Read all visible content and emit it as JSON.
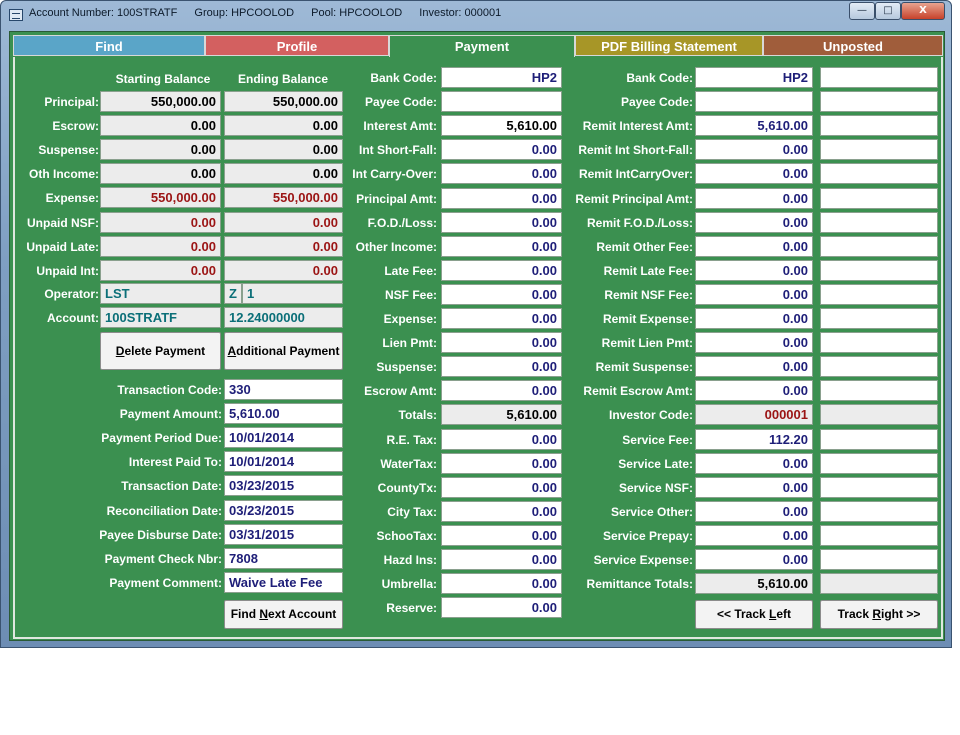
{
  "titlebar": {
    "segments": [
      "Account Number: 100STRATF",
      "Group: HPCOOLOD",
      "Pool: HPCOOLOD",
      "Investor: 000001"
    ],
    "minimize": "—",
    "maximize": "□",
    "close": "X"
  },
  "tabs": [
    {
      "label": "Find",
      "color": "#5aa5c8"
    },
    {
      "label": "Profile",
      "color": "#d36060"
    },
    {
      "label": "Payment",
      "color": "#3b9050"
    },
    {
      "label": "PDF Billing Statement",
      "color": "#a79627"
    },
    {
      "label": "Unposted",
      "color": "#a05d3b"
    }
  ],
  "balances": {
    "header_start": "Starting Balance",
    "header_end": "Ending Balance",
    "rows": [
      {
        "label": "Principal:",
        "start": "550,000.00",
        "end": "550,000.00",
        "color": "normal"
      },
      {
        "label": "Escrow:",
        "start": "0.00",
        "end": "0.00",
        "color": "normal"
      },
      {
        "label": "Suspense:",
        "start": "0.00",
        "end": "0.00",
        "color": "normal"
      },
      {
        "label": "Oth Income:",
        "start": "0.00",
        "end": "0.00",
        "color": "normal"
      },
      {
        "label": "Expense:",
        "start": "550,000.00",
        "end": "550,000.00",
        "color": "red"
      },
      {
        "label": "Unpaid NSF:",
        "start": "0.00",
        "end": "0.00",
        "color": "red"
      },
      {
        "label": "Unpaid Late:",
        "start": "0.00",
        "end": "0.00",
        "color": "red"
      },
      {
        "label": "Unpaid Int:",
        "start": "0.00",
        "end": "0.00",
        "color": "red"
      }
    ],
    "operator_label": "Operator:",
    "operator_value": "LST",
    "operator_code": "Z",
    "operator_num": "1",
    "account_label": "Account:",
    "account_value": "100STRATF",
    "account_rate": "12.24000000"
  },
  "buttons": {
    "delete": "Delete Payment",
    "additional": "Additional Payment",
    "find_next": "Find Next Account",
    "track_left": "<< Track Left",
    "track_right": "Track Right >>"
  },
  "transaction": [
    {
      "label": "Transaction Code:",
      "value": "330"
    },
    {
      "label": "Payment Amount:",
      "value": "5,610.00"
    },
    {
      "label": "Payment Period Due:",
      "value": "10/01/2014"
    },
    {
      "label": "Interest Paid To:",
      "value": "10/01/2014"
    },
    {
      "label": "Transaction Date:",
      "value": "03/23/2015"
    },
    {
      "label": "Reconciliation Date:",
      "value": "03/23/2015"
    },
    {
      "label": "Payee Disburse Date:",
      "value": "03/31/2015"
    },
    {
      "label": "Payment Check Nbr:",
      "value": "7808"
    },
    {
      "label": "Payment Comment:",
      "value": "Waive Late Fee"
    }
  ],
  "payment_col": [
    {
      "label": "Bank Code:",
      "value": "HP2",
      "ro": false
    },
    {
      "label": "Payee Code:",
      "value": "",
      "ro": false
    },
    {
      "label": "Interest Amt:",
      "value": "5,610.00",
      "ro": false,
      "dark": true
    },
    {
      "label": "Int Short-Fall:",
      "value": "0.00",
      "ro": false
    },
    {
      "label": "Int Carry-Over:",
      "value": "0.00",
      "ro": false
    },
    {
      "label": "Principal Amt:",
      "value": "0.00",
      "ro": false
    },
    {
      "label": "F.O.D./Loss:",
      "value": "0.00",
      "ro": false
    },
    {
      "label": "Other Income:",
      "value": "0.00",
      "ro": false
    },
    {
      "label": "Late Fee:",
      "value": "0.00",
      "ro": false
    },
    {
      "label": "NSF Fee:",
      "value": "0.00",
      "ro": false
    },
    {
      "label": "Expense:",
      "value": "0.00",
      "ro": false
    },
    {
      "label": "Lien Pmt:",
      "value": "0.00",
      "ro": false
    },
    {
      "label": "Suspense:",
      "value": "0.00",
      "ro": false
    },
    {
      "label": "Escrow Amt:",
      "value": "0.00",
      "ro": false
    },
    {
      "label": "Totals:",
      "value": "5,610.00",
      "ro": true
    },
    {
      "label": "R.E. Tax:",
      "value": "0.00",
      "ro": false
    },
    {
      "label": "WaterTax:",
      "value": "0.00",
      "ro": false
    },
    {
      "label": "CountyTx:",
      "value": "0.00",
      "ro": false
    },
    {
      "label": "City Tax:",
      "value": "0.00",
      "ro": false
    },
    {
      "label": "SchooTax:",
      "value": "0.00",
      "ro": false
    },
    {
      "label": "Hazd Ins:",
      "value": "0.00",
      "ro": false
    },
    {
      "label": "Umbrella:",
      "value": "0.00",
      "ro": false
    },
    {
      "label": "Reserve:",
      "value": "0.00",
      "ro": false
    }
  ],
  "remit_col": [
    {
      "label": "Bank Code:",
      "value": "HP2",
      "ro": false
    },
    {
      "label": "Payee Code:",
      "value": "",
      "ro": false
    },
    {
      "label": "Remit Interest Amt:",
      "value": "5,610.00",
      "ro": false
    },
    {
      "label": "Remit Int Short-Fall:",
      "value": "0.00",
      "ro": false
    },
    {
      "label": "Remit IntCarryOver:",
      "value": "0.00",
      "ro": false
    },
    {
      "label": "Remit Principal Amt:",
      "value": "0.00",
      "ro": false
    },
    {
      "label": "Remit F.O.D./Loss:",
      "value": "0.00",
      "ro": false
    },
    {
      "label": "Remit Other Fee:",
      "value": "0.00",
      "ro": false
    },
    {
      "label": "Remit Late Fee:",
      "value": "0.00",
      "ro": false
    },
    {
      "label": "Remit NSF Fee:",
      "value": "0.00",
      "ro": false
    },
    {
      "label": "Remit Expense:",
      "value": "0.00",
      "ro": false
    },
    {
      "label": "Remit Lien Pmt:",
      "value": "0.00",
      "ro": false
    },
    {
      "label": "Remit Suspense:",
      "value": "0.00",
      "ro": false
    },
    {
      "label": "Remit Escrow Amt:",
      "value": "0.00",
      "ro": false
    },
    {
      "label": "Investor Code:",
      "value": "000001",
      "ro": true,
      "red": true
    },
    {
      "label": "Service Fee:",
      "value": "112.20",
      "ro": false
    },
    {
      "label": "Service Late:",
      "value": "0.00",
      "ro": false
    },
    {
      "label": "Service NSF:",
      "value": "0.00",
      "ro": false
    },
    {
      "label": "Service Other:",
      "value": "0.00",
      "ro": false
    },
    {
      "label": "Service Prepay:",
      "value": "0.00",
      "ro": false
    },
    {
      "label": "Service Expense:",
      "value": "0.00",
      "ro": false
    },
    {
      "label": "Remittance Totals:",
      "value": "5,610.00",
      "ro": true
    }
  ]
}
